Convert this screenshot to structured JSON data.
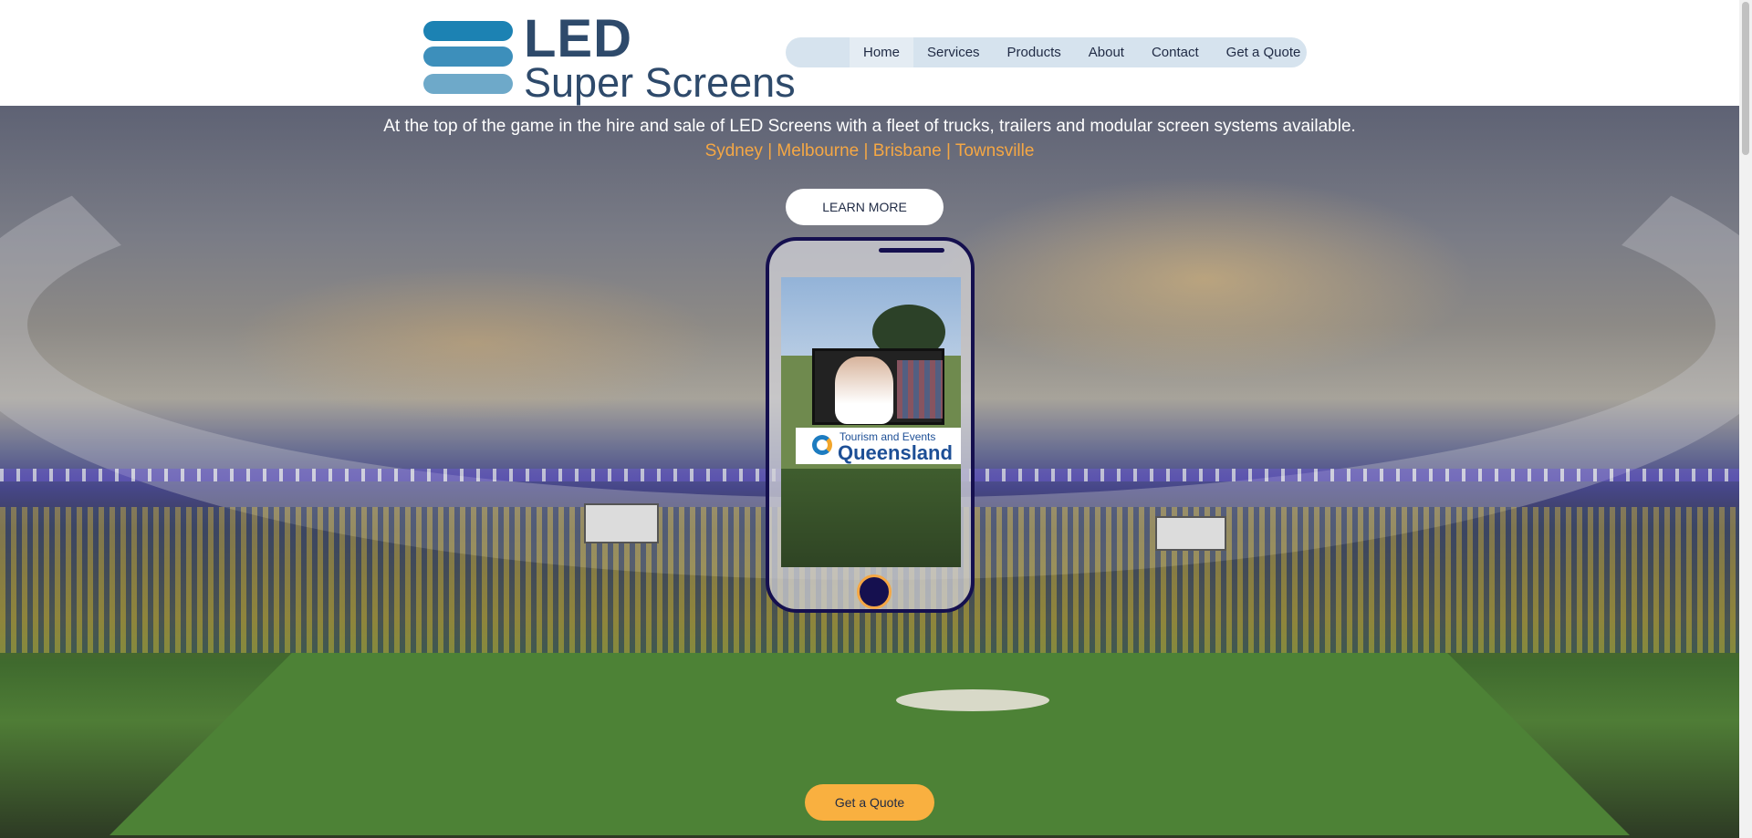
{
  "logo": {
    "line1": "LED",
    "line2": "Super Screens"
  },
  "nav": {
    "items": [
      {
        "label": "Home",
        "active": true
      },
      {
        "label": "Services"
      },
      {
        "label": "Products"
      },
      {
        "label": "About"
      },
      {
        "label": "Contact"
      },
      {
        "label": "Get a Quote"
      }
    ]
  },
  "hero": {
    "tagline": "At the top of the game in the hire and sale of LED Screens with a fleet of trucks, trailers and modular screen systems available.",
    "cities": "Sydney | Melbourne | Brisbane | Townsville",
    "learn_more_label": "LEARN MORE",
    "quote_label": "Get a Quote"
  },
  "phone_screen": {
    "banner_small": "Tourism and Events",
    "banner_big": "Queensland"
  },
  "colors": {
    "brand_blue": "#2e4a6b",
    "accent_orange": "#f5a744",
    "phone_frame": "#15104f",
    "nav_bg": "#d6e3ee"
  }
}
